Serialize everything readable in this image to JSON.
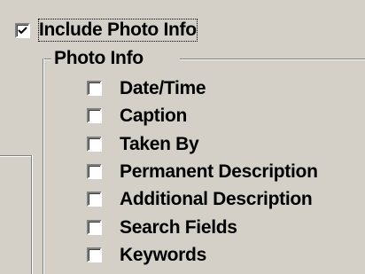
{
  "include_photo_info": {
    "label": "Include Photo Info",
    "checked": true
  },
  "photo_info_group": {
    "title": "Photo Info",
    "options": [
      {
        "label": "Date/Time",
        "checked": false
      },
      {
        "label": "Caption",
        "checked": false
      },
      {
        "label": "Taken By",
        "checked": false
      },
      {
        "label": "Permanent Description",
        "checked": false
      },
      {
        "label": "Additional Description",
        "checked": false
      },
      {
        "label": "Search Fields",
        "checked": false
      },
      {
        "label": "Keywords",
        "checked": false
      }
    ]
  }
}
